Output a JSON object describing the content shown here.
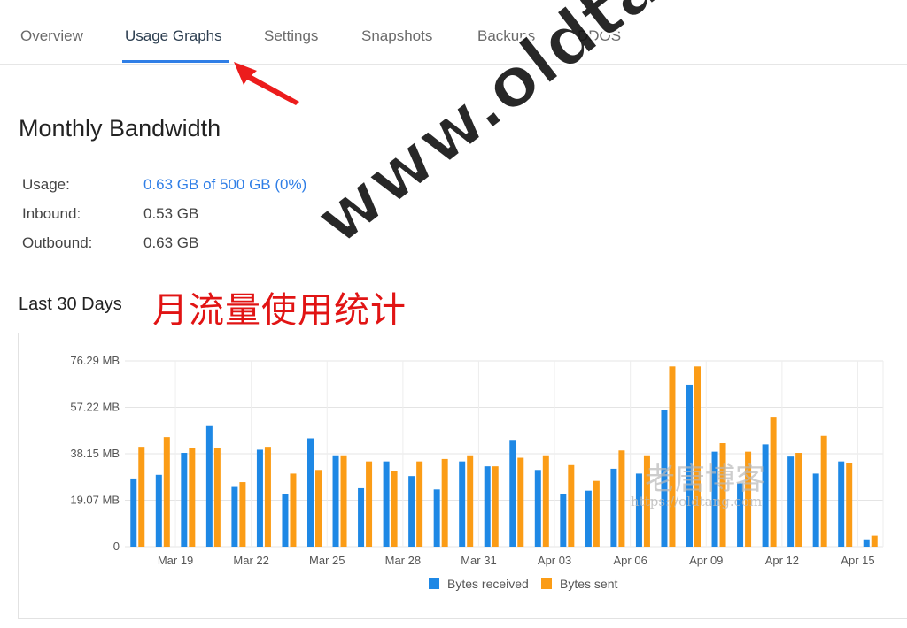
{
  "tabs": [
    {
      "label": "Overview",
      "active": false
    },
    {
      "label": "Usage Graphs",
      "active": true
    },
    {
      "label": "Settings",
      "active": false
    },
    {
      "label": "Snapshots",
      "active": false
    },
    {
      "label": "Backups",
      "active": false
    },
    {
      "label": "DDOS",
      "active": false
    }
  ],
  "bandwidth": {
    "title": "Monthly Bandwidth",
    "rows": [
      {
        "label": "Usage:",
        "value": "0.63 GB of 500 GB (0%)"
      },
      {
        "label": "Inbound:",
        "value": "0.53 GB"
      },
      {
        "label": "Outbound:",
        "value": "0.63 GB"
      }
    ]
  },
  "section_title": "Last 30 Days",
  "annotation": "月流量使用统计",
  "watermark": {
    "main": "www.oldtang.com",
    "cn": "老唐博客",
    "url": "https://oldtang.com"
  },
  "colors": {
    "accent": "#2f7ee6",
    "received": "#1e88e5",
    "sent": "#fb9c16",
    "annotation": "#e11414"
  },
  "chart_data": {
    "type": "bar",
    "ylim": [
      0,
      76.29
    ],
    "y_ticks": [
      {
        "value": 76.29,
        "label": "76.29 MB"
      },
      {
        "value": 57.22,
        "label": "57.22 MB"
      },
      {
        "value": 38.15,
        "label": "38.15 MB"
      },
      {
        "value": 19.07,
        "label": "19.07 MB"
      },
      {
        "value": 0,
        "label": "0"
      }
    ],
    "x_tick_labels": [
      "Mar 19",
      "Mar 22",
      "Mar 25",
      "Mar 28",
      "Mar 31",
      "Apr 03",
      "Apr 06",
      "Apr 09",
      "Apr 12",
      "Apr 15"
    ],
    "grid": true,
    "legend_position": "bottom",
    "series": [
      {
        "name": "Bytes received",
        "values": [
          28,
          29.5,
          38.5,
          49.5,
          24.5,
          39.8,
          21.5,
          44.5,
          37.5,
          24,
          35,
          29,
          23.5,
          35,
          33,
          43.5,
          31.5,
          21.5,
          23,
          32,
          30,
          56,
          66.5,
          39,
          26,
          42,
          37,
          30,
          35,
          3
        ]
      },
      {
        "name": "Bytes sent",
        "values": [
          41,
          45,
          40.5,
          40.5,
          26.5,
          41,
          30,
          31.5,
          37.5,
          35,
          31,
          35,
          36,
          37.5,
          33,
          36.5,
          37.5,
          33.5,
          27,
          39.5,
          37.5,
          74,
          74,
          42.5,
          39,
          53,
          38.5,
          45.5,
          34.5,
          4.5
        ]
      }
    ]
  }
}
